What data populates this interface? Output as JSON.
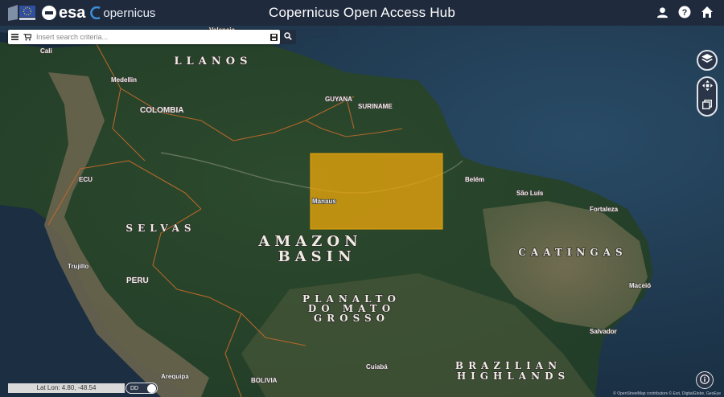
{
  "header": {
    "title": "Copernicus Open Access Hub",
    "esa_text": "esa",
    "copernicus_text": "opernicus"
  },
  "search": {
    "placeholder": "Insert search criteria..."
  },
  "map": {
    "place_labels": {
      "valencia": "Valencia",
      "cali": "Cali",
      "medellin": "Medellin",
      "colombia": "COLOMBIA",
      "guyana": "GUYANA",
      "suriname": "SURINAME",
      "belem": "Belém",
      "sao_luis": "São Luís",
      "fortaleza": "Fortaleza",
      "manaus": "Manaus",
      "trujillo": "Trujillo",
      "peru": "PERU",
      "maceio": "Maceió",
      "salvador": "Salvador",
      "cuiaba": "Cuiabá",
      "arequipa": "Arequipa",
      "bolivia": "BOLIVIA",
      "ecuador": "ECU"
    },
    "region_labels": {
      "llanos": "LLANOS",
      "selvas": "SELVAS",
      "amazon_1": "AMAZON",
      "amazon_2": "BASIN",
      "planalto_1": "PLANALTO",
      "planalto_2": "DO MATO",
      "planalto_3": "GROSSO",
      "caatingas": "CAATINGAS",
      "brazilian_1": "BRAZILIAN",
      "brazilian_2": "HIGHLANDS"
    },
    "selection_color": "#e8a40c"
  },
  "footer": {
    "latlon_text": "Lat Lon: 4.80, -48.54",
    "coord_mode": "DD",
    "attribution": "© OpenStreetMap contributors © Esri, DigitalGlobe, GeoEye"
  },
  "icons": {
    "user": "user-icon",
    "help": "help-icon",
    "home": "home-icon",
    "layers": "layers-icon",
    "pan": "pan-icon",
    "area_select": "area-select-icon",
    "info": "info-icon",
    "menu": "menu-icon",
    "cart": "cart-icon",
    "save": "save-icon",
    "search": "search-icon"
  }
}
